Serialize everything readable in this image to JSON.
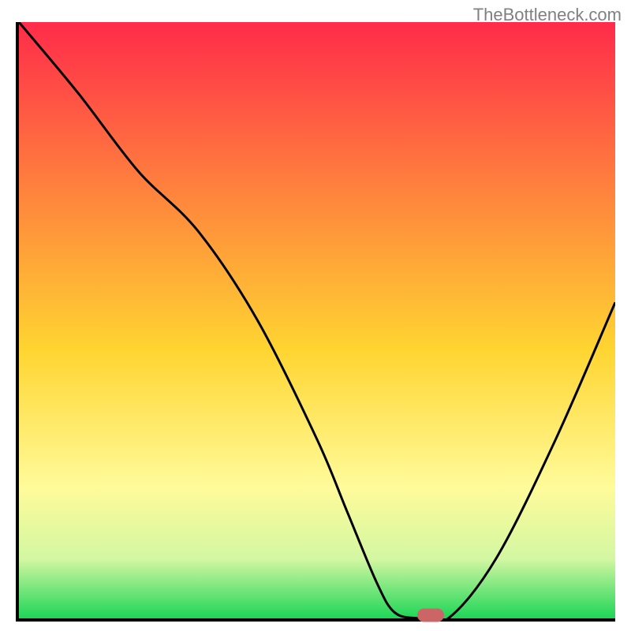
{
  "watermark": "TheBottleneck.com",
  "chart_data": {
    "type": "line",
    "title": "",
    "xlabel": "",
    "ylabel": "",
    "xlim": [
      0,
      100
    ],
    "ylim": [
      0,
      100
    ],
    "gradient_stops": [
      {
        "offset": 0,
        "color": "#ff2b4a"
      },
      {
        "offset": 55,
        "color": "#ffd531"
      },
      {
        "offset": 78,
        "color": "#fffb9a"
      },
      {
        "offset": 90,
        "color": "#d3f7a2"
      },
      {
        "offset": 100,
        "color": "#1dd657"
      }
    ],
    "x": [
      0,
      10,
      20,
      30,
      40,
      50,
      55,
      60,
      63,
      67,
      72,
      80,
      90,
      100
    ],
    "values": [
      100,
      88,
      75,
      65,
      50,
      30,
      18,
      6,
      1,
      0,
      0,
      10,
      30,
      53
    ],
    "marker": {
      "x": 69,
      "y": 0
    }
  }
}
